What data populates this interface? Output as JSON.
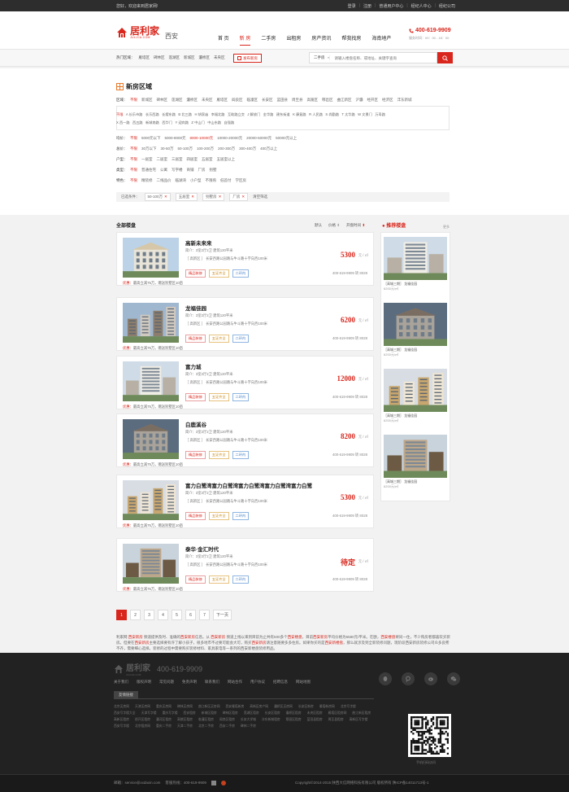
{
  "topbar": {
    "welcome": "您好，欢迎来到居家网!",
    "links": [
      "登录",
      "注册",
      "普通用户中心",
      "经纪人中心",
      "经纪公司"
    ]
  },
  "header": {
    "logo_cn": "居利家",
    "logo_en": "JULIJIA.COM",
    "city": "西安",
    "nav": [
      "首 页",
      "新 房",
      "二手房",
      "出租房",
      "房产资讯",
      "帮我找房",
      "海南地产"
    ],
    "active_nav": 1,
    "hotline": "400-619-9909",
    "hours": "服务时间：09：00 - 18：00"
  },
  "search": {
    "hot_label": "热门区域：",
    "hot": [
      "雁塔区",
      "碑林区",
      "莲湖区",
      "新城区",
      "灞桥区",
      "未央区"
    ],
    "publish": "发布新房",
    "type": "二手房",
    "placeholder": "请输入楼盘名称、或地址、关键字查询"
  },
  "filter": {
    "title": "新房区域",
    "area_label": "区域：",
    "area": [
      "不限",
      "新城区",
      "碑林区",
      "莲湖区",
      "灞桥区",
      "未央区",
      "雁塔区",
      "阎良区",
      "临潼区",
      "长安区",
      "蓝田县",
      "周至县",
      "高陵区",
      "鄠邑区",
      "曲江新区",
      "沪灞",
      "经开区",
      "经济区",
      "沣东新城"
    ],
    "sub1": [
      "不限",
      "A 长乐市路",
      "长乐西路",
      "长缨东路",
      "B 北三路",
      "H 胡家庙",
      "幸福北路",
      "互助路立交",
      "J 解放门",
      "金华路",
      "建东街道",
      "K 康复路",
      "R 人民路",
      "S 尚勤路",
      "T 太华路",
      "W 文景门",
      "万寿路"
    ],
    "sub2": [
      "X 西一路",
      "西五路",
      "新城南路",
      "西华门",
      "Y 迎宾路",
      "Z 中山门",
      "中山东路",
      "自强路"
    ],
    "price_label": "均价：",
    "price": [
      "不限",
      "5000元以下",
      "5000-8000元",
      "8000-10000元",
      "10000-20000元",
      "20000-50000元",
      "50000元以上"
    ],
    "total_label": "总价：",
    "total": [
      "不限",
      "30万以下",
      "30-50万",
      "50-100万",
      "100-200万",
      "200-300万",
      "300-400万",
      "400万以上"
    ],
    "layout_label": "户型：",
    "layout": [
      "不限",
      "一居室",
      "二居室",
      "三居室",
      "四居室",
      "五居室",
      "五居室以上"
    ],
    "type_label": "类型：",
    "type": [
      "不限",
      "普通住宅",
      "公寓",
      "写字楼",
      "商铺",
      "厂房",
      "别墅"
    ],
    "feature_label": "特色：",
    "feature": [
      "不限",
      "精装修",
      "二线品价",
      "临湖湾",
      "小户型",
      "不限购",
      "低首付",
      "学区房"
    ],
    "chosen_label": "已选条件：",
    "chosen": [
      "50-100万",
      "五居室",
      "别墅房",
      "厂房"
    ],
    "clear": "清空筛选"
  },
  "list": {
    "title": "全部楼盘",
    "sorts": [
      "默认",
      "价格",
      "开盘时间"
    ],
    "items": [
      {
        "name": "高新未来来",
        "intro": "简介：3室2厅2卫 建筑120平米",
        "addr": "［ 高新区 ］ 长安西路公园路与牛斗路十字向西100米",
        "tags": [
          "精品装修",
          "五证齐全",
          "二环内"
        ],
        "price": "5300",
        "unit": "元 / ㎡",
        "phone": "400-619-9909 转 8028",
        "promo_label": "优惠：",
        "promo": "最高立减75万，赠送别墅区10亩"
      },
      {
        "name": "龙福佳园",
        "intro": "简介：3室2厅2卫 建筑120平米",
        "addr": "［ 高新区 ］ 长安西路公园路与牛斗路十字向西100米",
        "tags": [
          "精品装修",
          "五证齐全",
          "二环内"
        ],
        "price": "6200",
        "unit": "元 / ㎡",
        "phone": "400-619-9909 转 8028",
        "promo_label": "优惠：",
        "promo": "最高立减75万，赠送别墅区10亩"
      },
      {
        "name": "富力城",
        "intro": "简介：3室2厅2卫 建筑120平米",
        "addr": "［ 高新区 ］ 长安西路公园路与牛斗路十字向西100米",
        "tags": [
          "精品装修",
          "五证齐全",
          "二环内"
        ],
        "price": "12000",
        "unit": "元 / ㎡",
        "phone": "400-619-9909 转 8028",
        "promo_label": "优惠：",
        "promo": "最高立减75万，赠送别墅区10亩"
      },
      {
        "name": "白鹿溪谷",
        "intro": "简介：3室2厅2卫 建筑120平米",
        "addr": "［ 高新区 ］ 长安西路公园路与牛斗路十字向西100米",
        "tags": [
          "精品装修",
          "五证齐全",
          "二环内"
        ],
        "price": "8200",
        "unit": "元 / ㎡",
        "phone": "400-619-9909 转 8028",
        "promo_label": "优惠：",
        "promo": "最高立减75万，赠送别墅区10亩"
      },
      {
        "name": "富力白鹭湾富力白鹭湾富力白鹭湾富力白鹭湾富力白鹭",
        "intro": "简介：3室2厅2卫 建筑120平米",
        "addr": "［ 高新区 ］ 长安西路公园路与牛斗路十字向西100米",
        "tags": [
          "精品装修",
          "五证齐全",
          "二环内"
        ],
        "price": "5300",
        "unit": "元 / ㎡",
        "phone": "400-619-9909 转 8028",
        "promo_label": "优惠：",
        "promo": "最高立减75万，赠送别墅区10亩"
      },
      {
        "name": "泰华·金汇时代",
        "intro": "简介：3室2厅2卫 建筑120平米",
        "addr": "［ 高新区 ］ 长安西路公园路与牛斗路十字向西100米",
        "tags": [
          "精品装修",
          "五证齐全",
          "二环内"
        ],
        "price": "待定",
        "unit": "元 / ㎡",
        "phone": "400-619-9909 转 8028",
        "promo_label": "优惠：",
        "promo": "最高立减75万，赠送别墅区10亩"
      }
    ]
  },
  "recommend": {
    "title": "推荐楼盘",
    "more": "更多",
    "items": [
      {
        "title": "［高城三期］ 龙福佳园",
        "price": "6200元/㎡"
      },
      {
        "title": "［高城三期］ 龙福佳园",
        "price": "6200元/㎡"
      },
      {
        "title": "［高城三期］ 龙福佳园",
        "price": "6200元/㎡"
      },
      {
        "title": "［高城三期］ 龙福佳园",
        "price": "6200元/㎡"
      }
    ]
  },
  "pager": {
    "pages": [
      "1",
      "2",
      "3",
      "4",
      "5",
      "6",
      "7"
    ],
    "current": 0,
    "next": "下一页"
  },
  "seo": {
    "p1": "利家网",
    "k1": "西安新房",
    "p2": "频道提供及时、准确的",
    "k2": "西安新房",
    "p3": "信息。从",
    "k3": "西安新房",
    "p4": "频道上线以来到目前为止共有500多个",
    "k4": "西安楼盘",
    "p5": "，目前",
    "k5": "西安新房",
    "p6": "平均价格为6580元/平米。在欧，",
    "k6": "西安楼盘",
    "p7": "将同一住，不少购房者都喜欢买新房。但要在",
    "k7": "西安新房",
    "p8": "主要选择要有许了解小孩子，很多地市不过要可能会大可，购买",
    "k8": "西安新房",
    "p9": "请注意随要多多住房。如果你买的是",
    "k9": "西安新楼盘",
    "p10": "，那么就涉及到全新装修问题，现阶段西安新房装修公司众多良莠不齐，需要细心选择。装修的过程中需要购买装修材料、家具家电等一系列的西安新楼盘装修用品。"
  },
  "footer": {
    "logo_cn": "居利家",
    "logo_en": "JULIJIA.COM",
    "phone": "400-619-9909",
    "links": [
      "关于我们",
      "版权声明",
      "常见问题",
      "免责声明",
      "联系我们",
      "网站合作",
      "用户协议",
      "招聘信息",
      "网站地图"
    ],
    "friend_label": "友情链接",
    "friend": [
      "北京买房网",
      "天津买房网",
      "重庆买房网",
      "碑林买房网",
      "曲江新区买房网",
      "西安雁塔新房",
      "高新区房产网",
      "灞桥区买房网",
      "长安区新房",
      "雁塔新房网",
      "北京写字楼",
      "西安写字楼大全",
      "天津写字楼",
      "重庆写字楼",
      "西安租房",
      "新城区租房",
      "碑林区租房",
      "莲湖区租房",
      "长安区租房",
      "灞桥区租房",
      "未央区租房",
      "雁塔区租房网",
      "曲江新区租房",
      "高新区租房",
      "经开区租房",
      "灞河区租房",
      "高陵区租房",
      "临潼区租房",
      "阎良区租房",
      "长安大学城",
      "沣东新城租房",
      "鄠邑区租房",
      "蓝田县租房",
      "周至县租房",
      "高新区写字楼",
      "西安写字楼",
      "北京租房网",
      "重庆二手房",
      "天津二手房",
      "北京二手房",
      "西安二手房",
      "碑林二手房"
    ],
    "qr_caption": "手机扫码访问",
    "email": "邮箱：service@xxdaxin.com",
    "tel": "客服热线：400-619-9909",
    "copyright": "Copyright©2014-2015 陕西大信网络科技有限公司 版权所有  陕ICP备14011713号-1"
  },
  "colors": {
    "brand": "#d9261c",
    "footer": "#222222",
    "orange": "#e8792a"
  }
}
